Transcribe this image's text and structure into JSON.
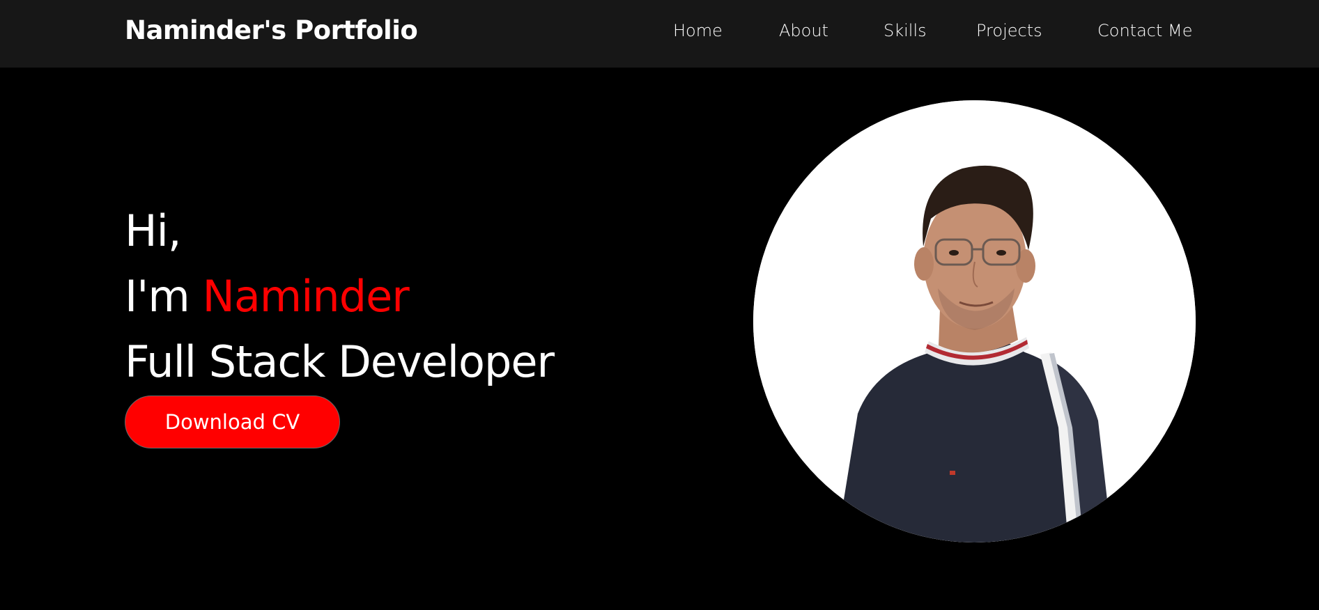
{
  "navbar": {
    "brand": "Naminder's Portfolio",
    "links": [
      {
        "label": "Home"
      },
      {
        "label": "About"
      },
      {
        "label": "Skills"
      },
      {
        "label": "Projects"
      },
      {
        "label": "Contact Me"
      }
    ]
  },
  "hero": {
    "greeting": "Hi,",
    "intro_prefix": "I'm ",
    "name": "Naminder",
    "role": "Full Stack Developer",
    "cta_label": "Download CV"
  },
  "colors": {
    "background": "#000000",
    "navbar": "#171717",
    "accent": "#ff0000",
    "text": "#ffffff"
  }
}
